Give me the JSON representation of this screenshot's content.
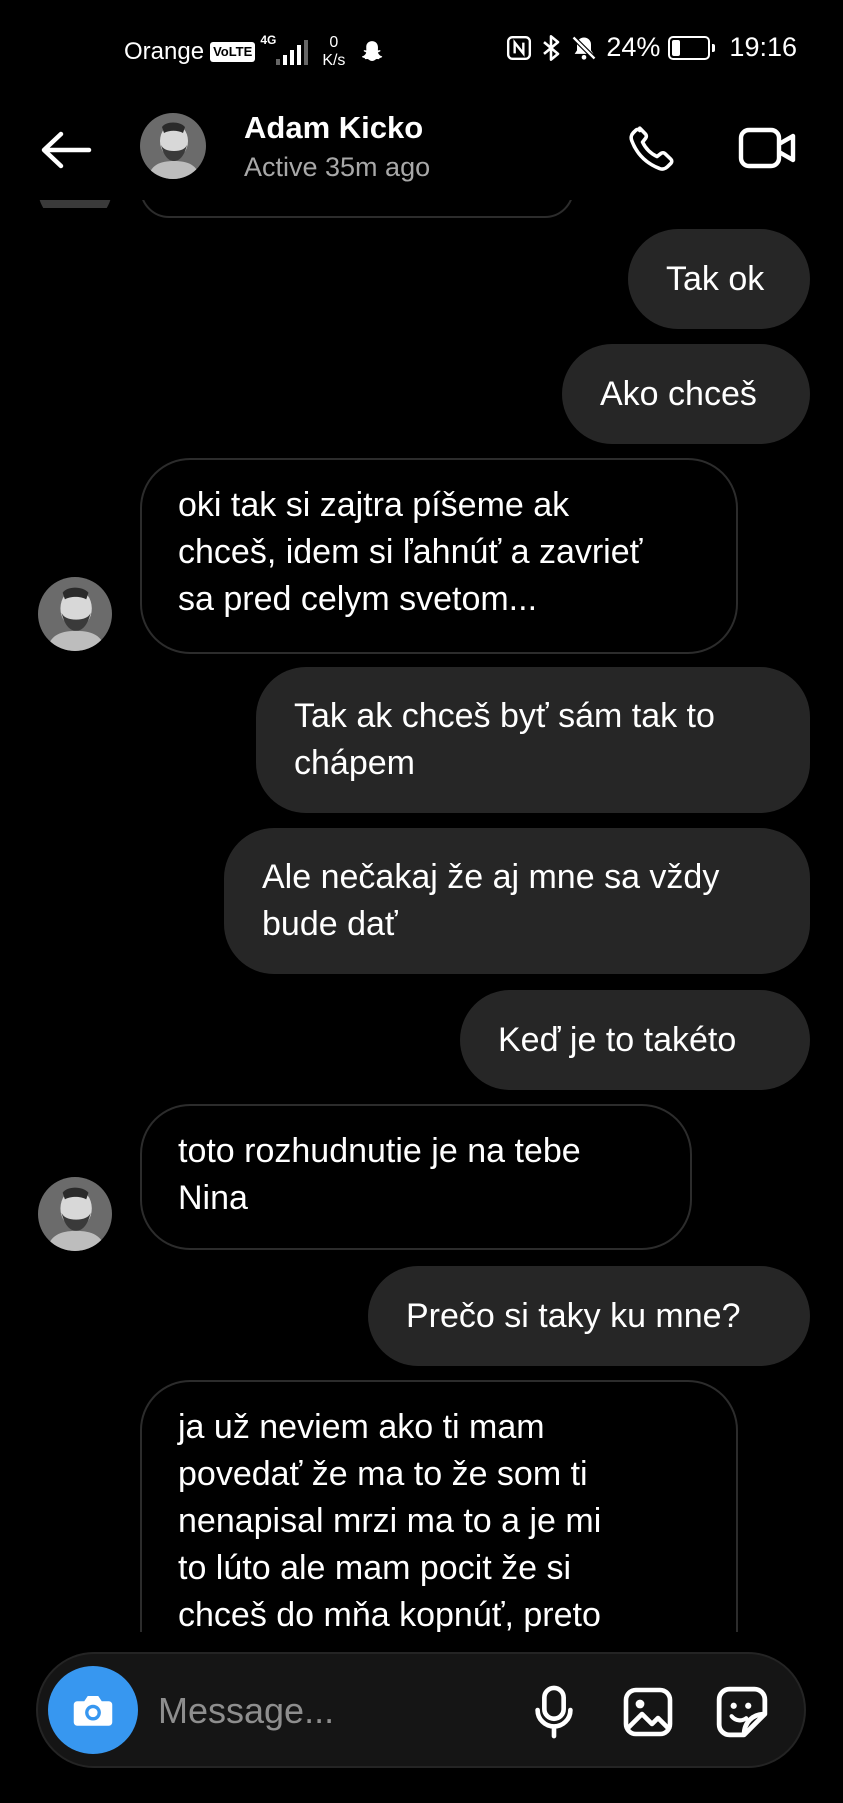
{
  "status_bar": {
    "carrier": "Orange",
    "volte": "VoLTE",
    "network": "4G",
    "speed_value": "0",
    "speed_unit": "K/s",
    "battery_percent": "24%",
    "battery_level": 0.24,
    "time": "19:16",
    "icons": [
      "snapchat-icon",
      "nfc-icon",
      "bluetooth-icon",
      "mute-icon"
    ]
  },
  "header": {
    "contact_name": "Adam Kicko",
    "active_status": "Active 35m ago",
    "icons": [
      "back-arrow-icon",
      "phone-icon",
      "video-camera-icon"
    ]
  },
  "messages": [
    {
      "side": "out",
      "text": "Tak ok"
    },
    {
      "side": "out",
      "text": "Ako chceš"
    },
    {
      "side": "in",
      "lines": [
        "oki tak si zajtra píšeme ak",
        "chceš, idem si ľahnúť a zavrieť",
        "sa pred celym svetom..."
      ]
    },
    {
      "side": "out",
      "lines": [
        "Tak ak chceš byť sám tak to",
        "chápem"
      ]
    },
    {
      "side": "out",
      "lines": [
        "Ale nečakaj že aj mne sa vždy",
        "bude dať"
      ]
    },
    {
      "side": "out",
      "text": "Keď je to takéto"
    },
    {
      "side": "in",
      "lines": [
        "toto rozhudnutie je na tebe",
        "Nina"
      ]
    },
    {
      "side": "out",
      "text": "Prečo si taky ku mne?"
    },
    {
      "side": "in",
      "lines": [
        "ja už neviem ako ti mam",
        "povedať že ma to že som ti",
        "nenapisal mrzi  ma to a je mi",
        "to lúto ale mam pocit že si",
        "chceš do mňa kopnúť, preto"
      ]
    }
  ],
  "composer": {
    "placeholder": "Message...",
    "icons": [
      "camera-icon",
      "microphone-icon",
      "gallery-icon",
      "sticker-icon"
    ]
  },
  "colors": {
    "background": "#000000",
    "outgoing_bubble": "#262626",
    "incoming_border": "#2c2c2c",
    "camera_button": "#3797f0",
    "secondary_text": "#a8a8a8"
  }
}
